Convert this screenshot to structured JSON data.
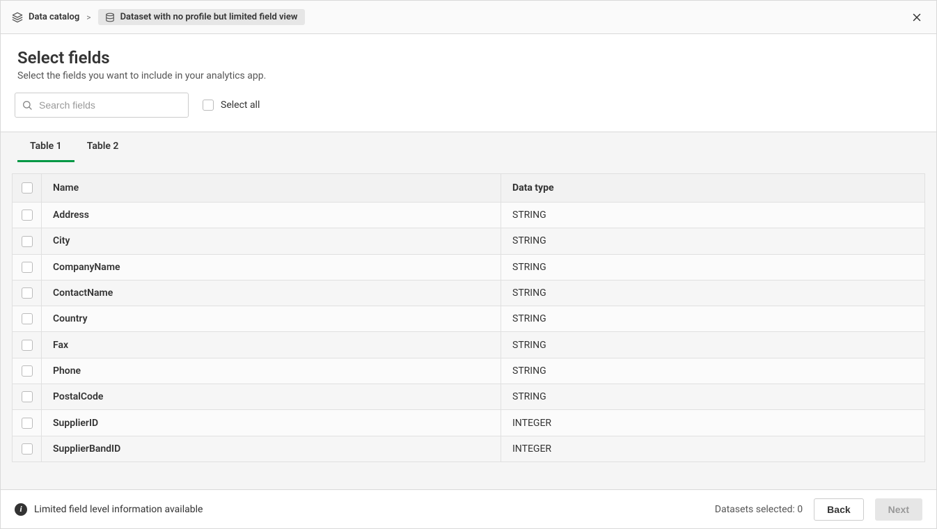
{
  "breadcrumb": {
    "root": "Data catalog",
    "separator": ">",
    "current": "Dataset with no profile but limited field view"
  },
  "header": {
    "title": "Select fields",
    "subtitle": "Select the fields you want to include in your analytics app."
  },
  "controls": {
    "search_placeholder": "Search fields",
    "select_all_label": "Select all"
  },
  "tabs": [
    {
      "label": "Table 1",
      "active": true
    },
    {
      "label": "Table 2",
      "active": false
    }
  ],
  "table": {
    "columns": {
      "name": "Name",
      "type": "Data type"
    },
    "rows": [
      {
        "name": "Address",
        "type": "STRING"
      },
      {
        "name": "City",
        "type": "STRING"
      },
      {
        "name": "CompanyName",
        "type": "STRING"
      },
      {
        "name": "ContactName",
        "type": "STRING"
      },
      {
        "name": "Country",
        "type": "STRING"
      },
      {
        "name": "Fax",
        "type": "STRING"
      },
      {
        "name": "Phone",
        "type": "STRING"
      },
      {
        "name": "PostalCode",
        "type": "STRING"
      },
      {
        "name": "SupplierID",
        "type": "INTEGER"
      },
      {
        "name": "SupplierBandID",
        "type": "INTEGER"
      }
    ]
  },
  "footer": {
    "info_text": "Limited field level information available",
    "datasets_label": "Datasets selected: 0",
    "back_label": "Back",
    "next_label": "Next"
  }
}
